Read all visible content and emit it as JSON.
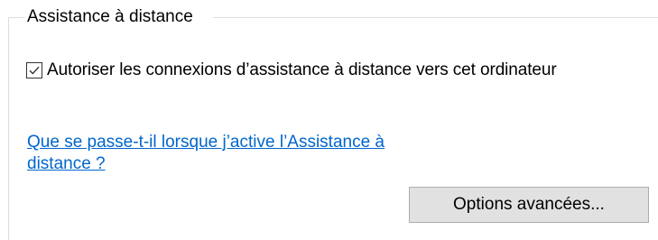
{
  "group": {
    "title": "Assistance à distance"
  },
  "checkbox": {
    "label": "Autoriser les connexions d’assistance à distance vers cet ordinateur",
    "checked": true
  },
  "help_link": {
    "line1": "Que se passe-t-il lorsque j’active l’Assistance à",
    "line2": "distance ?",
    "color": "#0066cc"
  },
  "advanced_button": {
    "label": "Options avancées..."
  }
}
